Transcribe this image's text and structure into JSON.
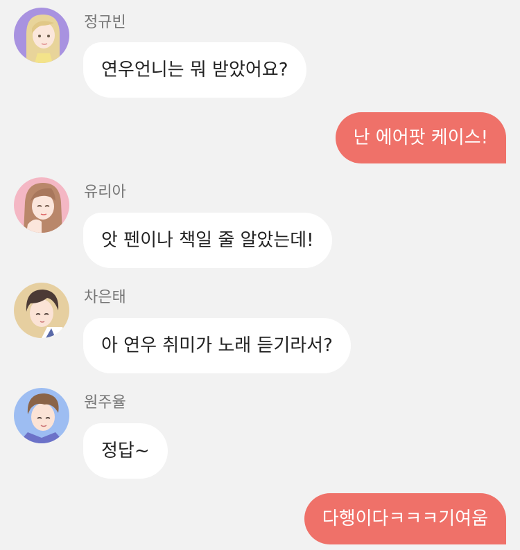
{
  "accent_color": "#ef7169",
  "messages": [
    {
      "sender": "정규빈",
      "text": "연우언니는 뭐 받았어요?",
      "avatar_icon": "girl-blonde-avatar-icon"
    },
    {
      "text": "난 에어팟 케이스!"
    },
    {
      "sender": "유리아",
      "text": "앗 펜이나 책일 줄 알았는데!",
      "avatar_icon": "girl-brunette-avatar-icon"
    },
    {
      "sender": "차은태",
      "text": "아 연우 취미가 노래 듣기라서?",
      "avatar_icon": "boy-darkhair-avatar-icon"
    },
    {
      "sender": "원주율",
      "text": "정답~",
      "avatar_icon": "boy-brownhair-avatar-icon"
    },
    {
      "text": "다행이다ㅋㅋㅋ기여움"
    }
  ]
}
